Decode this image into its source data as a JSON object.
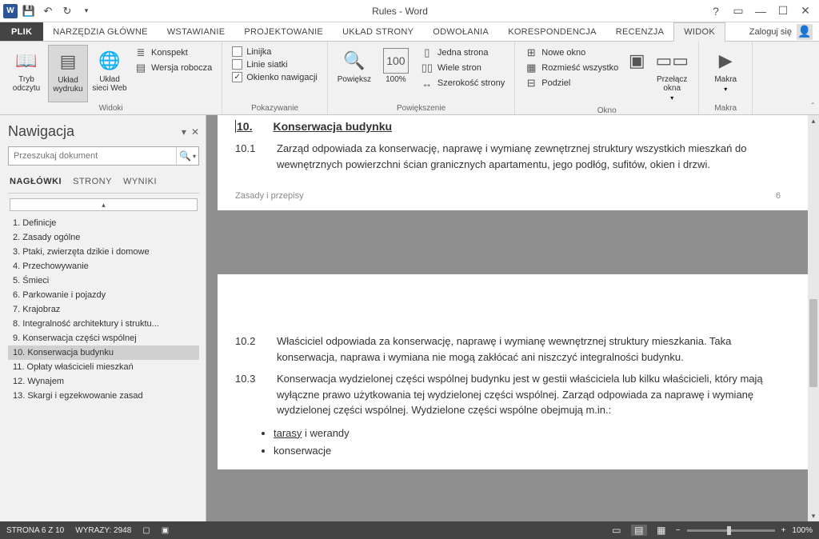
{
  "titlebar": {
    "title": "Rules - Word"
  },
  "tabs": {
    "file": "PLIK",
    "items": [
      "NARZĘDZIA GŁÓWNE",
      "WSTAWIANIE",
      "PROJEKTOWANIE",
      "UKŁAD STRONY",
      "ODWOŁANIA",
      "KORESPONDENCJA",
      "RECENZJA",
      "WIDOK"
    ],
    "login": "Zaloguj się"
  },
  "ribbon": {
    "views": {
      "read": "Tryb odczytu",
      "print": "Układ wydruku",
      "web": "Układ sieci Web",
      "outline": "Konspekt",
      "draft": "Wersja robocza",
      "group": "Widoki"
    },
    "show": {
      "ruler": "Linijka",
      "gridlines": "Linie siatki",
      "navpane": "Okienko nawigacji",
      "group": "Pokazywanie"
    },
    "zoom": {
      "zoom": "Powiększ",
      "hundred": "100%",
      "onepage": "Jedna strona",
      "multipage": "Wiele stron",
      "pagewidth": "Szerokość strony",
      "group": "Powiększenie"
    },
    "window": {
      "new": "Nowe okno",
      "arrange": "Rozmieść wszystko",
      "split": "Podziel",
      "switch": "Przełącz okna",
      "group": "Okno"
    },
    "macros": {
      "macros": "Makra",
      "group": "Makra"
    }
  },
  "navpane": {
    "title": "Nawigacja",
    "search_placeholder": "Przeszukaj dokument",
    "tabs": {
      "headings": "NAGŁÓWKI",
      "pages": "STRONY",
      "results": "WYNIKI"
    },
    "items": [
      "1. Definicje",
      "2. Zasady ogólne",
      "3. Ptaki, zwierzęta dzikie i domowe",
      "4. Przechowywanie",
      "5. Śmieci",
      "6. Parkowanie i pojazdy",
      "7. Krajobraz",
      "8. Integralność architektury i struktu...",
      "9. Konserwacja części wspólnej",
      "10. Konserwacja budynku",
      "11. Opłaty właścicieli mieszkań",
      "12. Wynajem",
      "13. Skargi i egzekwowanie zasad"
    ],
    "selected_index": 9
  },
  "document": {
    "heading_num": "10.",
    "heading_text": "Konserwacja budynku",
    "p1_num": "10.1",
    "p1_text": "Zarząd odpowiada za konserwację, naprawę i wymianę zewnętrznej struktury wszystkich mieszkań do wewnętrznych powierzchni ścian granicznych apartamentu, jego podłóg, sufitów, okien i drzwi.",
    "footer_left": "Zasady i przepisy",
    "footer_right": "6",
    "p2_num": "10.2",
    "p2_text": "Właściciel odpowiada za konserwację, naprawę i wymianę wewnętrznej struktury mieszkania. Taka konserwacja, naprawa i wymiana nie mogą zakłócać ani niszczyć integralności budynku.",
    "p3_num": "10.3",
    "p3_text": "Konserwacja wydzielonej części wspólnej budynku jest w gestii właściciela lub kilku właścicieli, który mają wyłączne prawo użytkowania tej wydzielonej części wspólnej. Zarząd odpowiada za naprawę i wymianę wydzielonej części wspólnej. Wydzielone części wspólne obejmują m.in.:",
    "bullet1a": "tarasy",
    "bullet1b": " i werandy",
    "bullet2": "konserwacje"
  },
  "statusbar": {
    "page": "STRONA 6 Z 10",
    "words": "WYRAZY: 2948",
    "zoom": "100%"
  }
}
